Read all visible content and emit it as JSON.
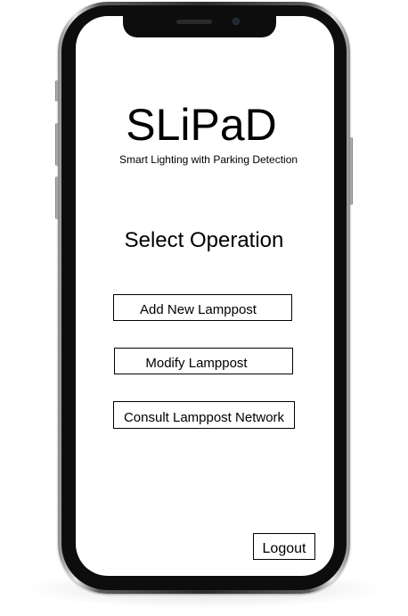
{
  "app": {
    "title": "SLiPaD",
    "subtitle": "Smart Lighting with Parking Detection"
  },
  "main": {
    "heading": "Select Operation",
    "buttons": {
      "add": "Add New Lamppost",
      "modify": "Modify Lamppost",
      "consult": "Consult Lamppost Network"
    }
  },
  "footer": {
    "logout": "Logout"
  }
}
